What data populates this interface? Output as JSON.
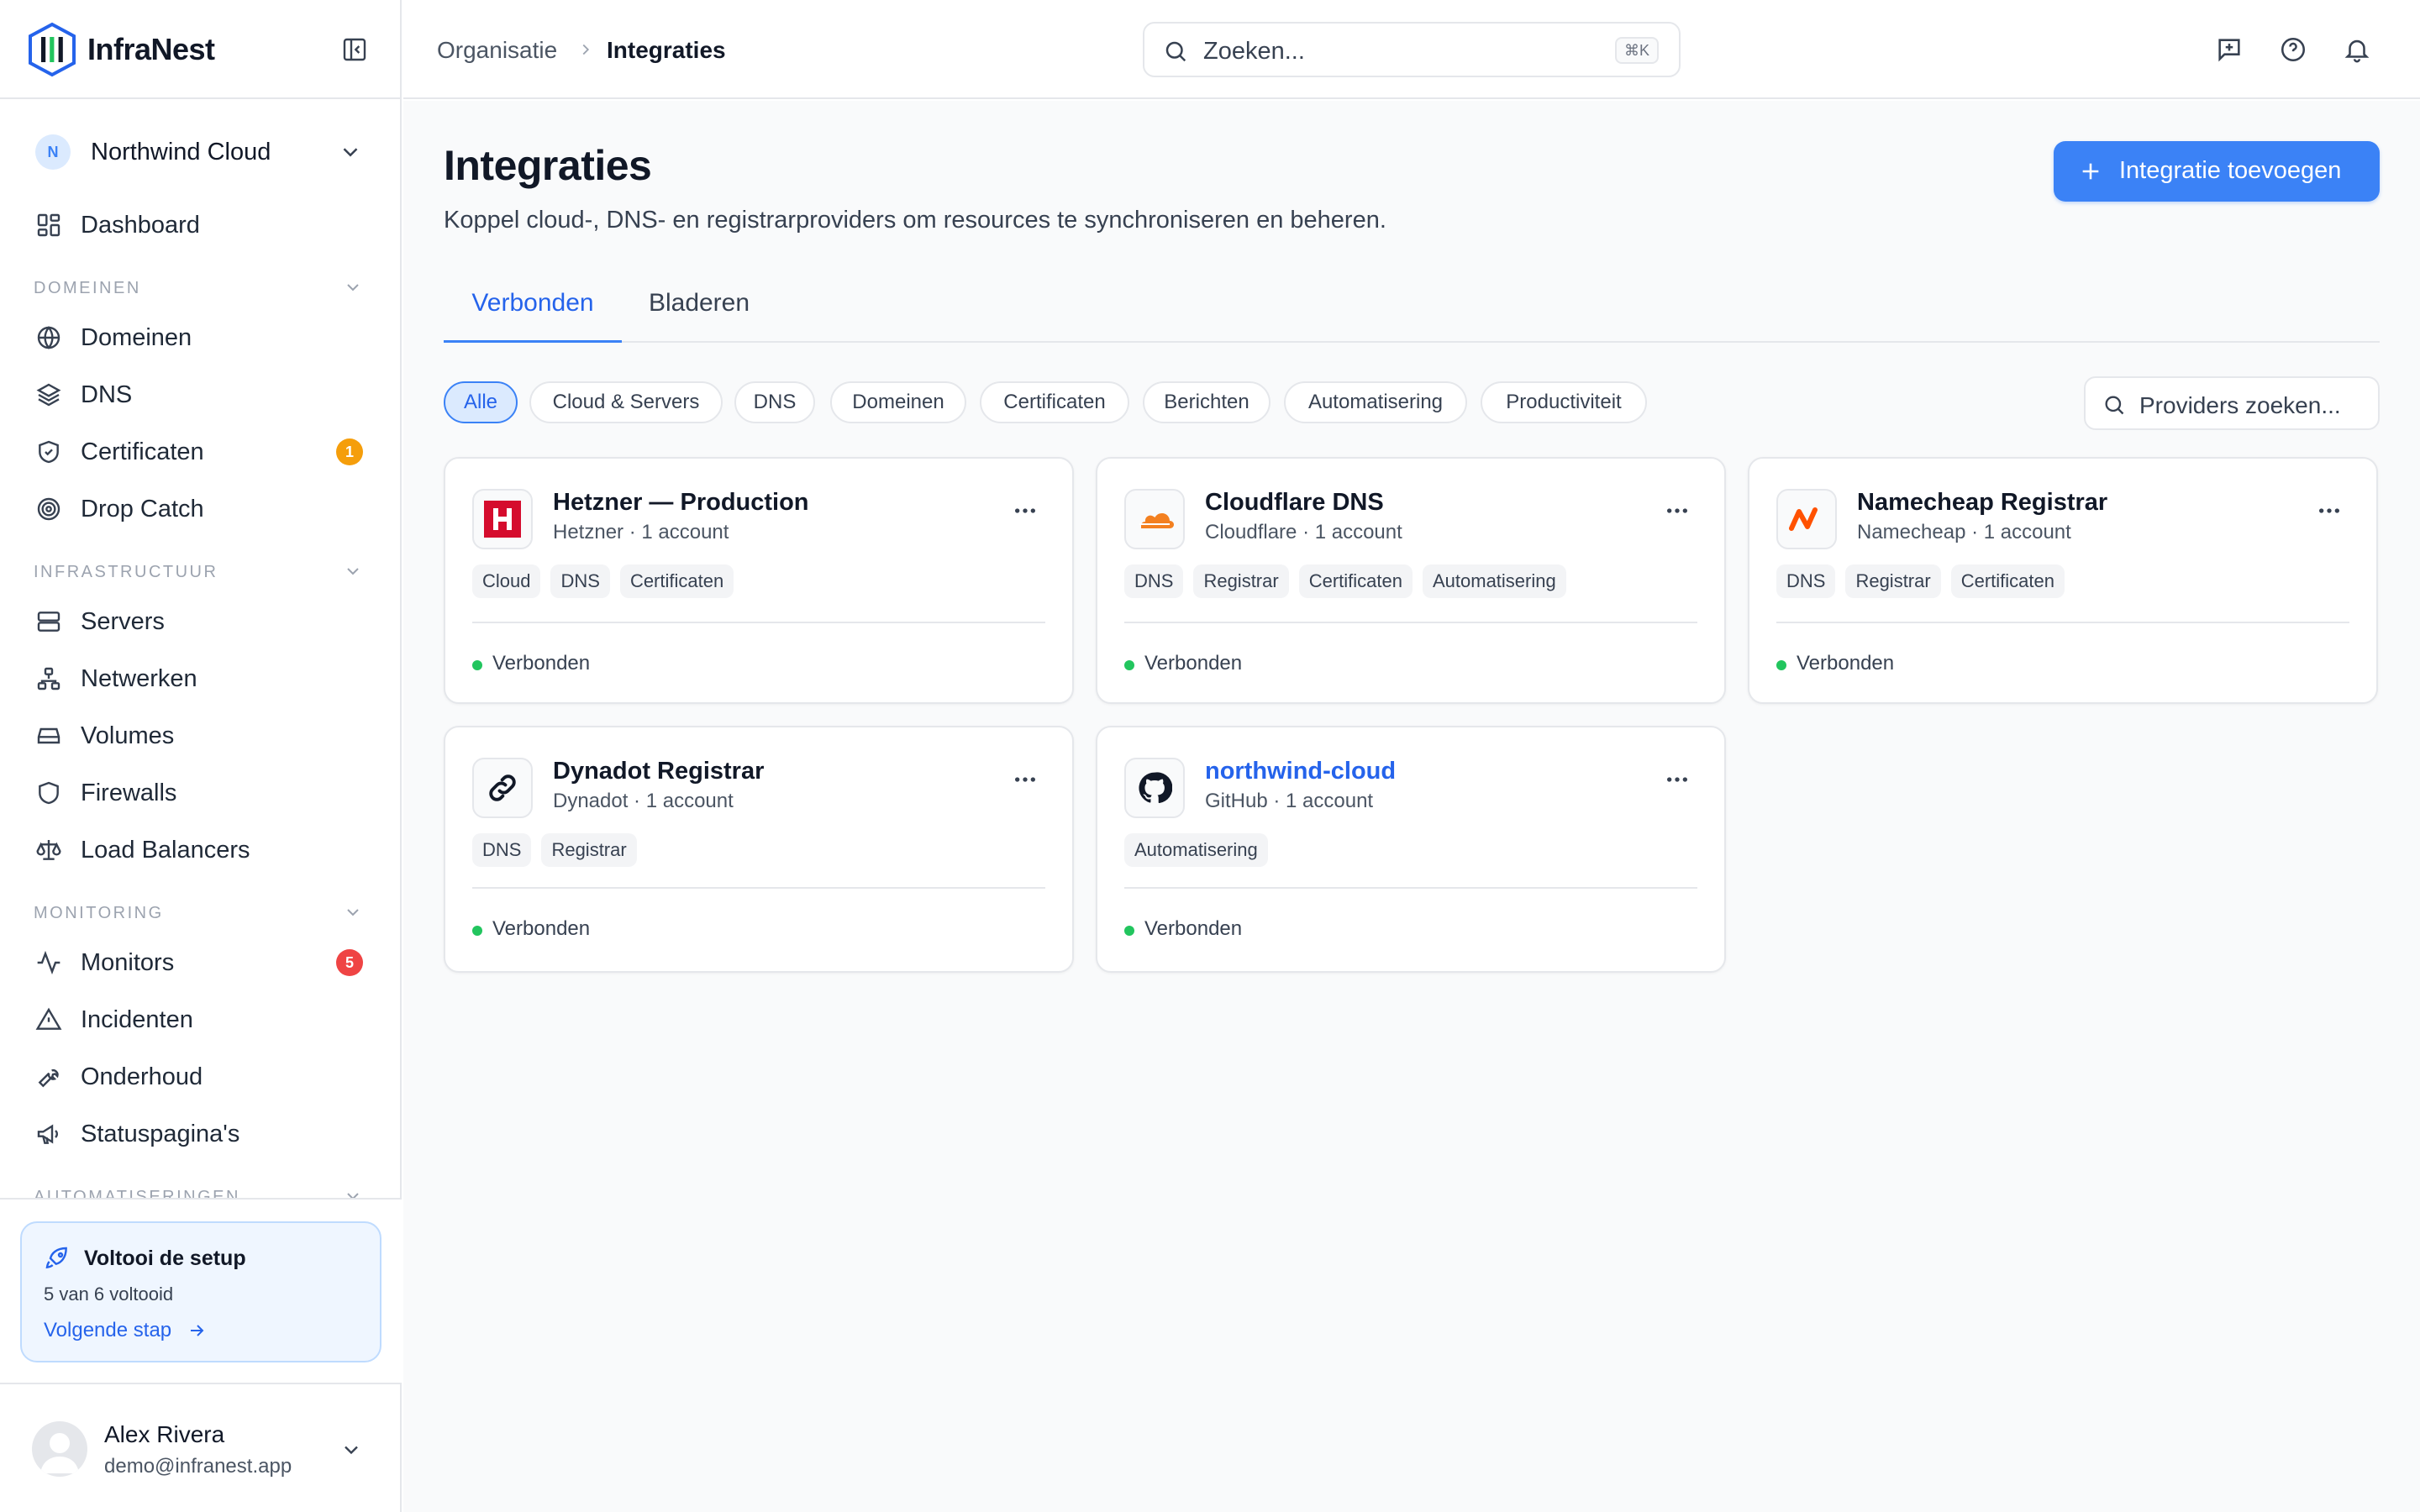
{
  "brand": {
    "name": "InfraNest"
  },
  "org": {
    "initial": "N",
    "name": "Northwind Cloud"
  },
  "nav": {
    "dashboard": "Dashboard",
    "domains_section": "DOMEINEN",
    "domains": "Domeinen",
    "dns": "DNS",
    "certificates": "Certificaten",
    "certificates_badge": "1",
    "drop_catch": "Drop Catch",
    "infra_section": "INFRASTRUCTUUR",
    "servers": "Servers",
    "networks": "Netwerken",
    "volumes": "Volumes",
    "firewalls": "Firewalls",
    "load_balancers": "Load Balancers",
    "monitoring_section": "MONITORING",
    "monitors": "Monitors",
    "monitors_badge": "5",
    "incidents": "Incidenten",
    "maintenance": "Onderhoud",
    "status_pages": "Statuspagina's",
    "automations_section": "AUTOMATISERINGEN"
  },
  "setup": {
    "title": "Voltooi de setup",
    "progress": "5 van 6 voltooid",
    "next": "Volgende stap"
  },
  "user": {
    "name": "Alex Rivera",
    "email": "demo@infranest.app"
  },
  "breadcrumb": {
    "parent": "Organisatie",
    "current": "Integraties"
  },
  "search": {
    "placeholder": "Zoeken...",
    "shortcut": "⌘K"
  },
  "page": {
    "title": "Integraties",
    "description": "Koppel cloud-, DNS- en registrarproviders om resources te synchroniseren en beheren.",
    "add_button": "Integratie toevoegen"
  },
  "tabs": {
    "connected": "Verbonden",
    "browse": "Bladeren"
  },
  "filters": [
    "Alle",
    "Cloud & Servers",
    "DNS",
    "Domeinen",
    "Certificaten",
    "Berichten",
    "Automatisering",
    "Productiviteit"
  ],
  "provider_search": {
    "placeholder": "Providers zoeken..."
  },
  "colors": {
    "accent": "#3b82f6",
    "connected": "#22c55e",
    "hetzner": "#d50c2d",
    "cloudflare": "#f38020",
    "namecheap": "#ff5100"
  },
  "integrations": [
    {
      "name": "Hetzner — Production",
      "meta": "Hetzner · 1 account",
      "tags": [
        "Cloud",
        "DNS",
        "Certificaten"
      ],
      "status": "Verbonden",
      "icon": "hetzner-logo-icon"
    },
    {
      "name": "Cloudflare DNS",
      "meta": "Cloudflare · 1 account",
      "tags": [
        "DNS",
        "Registrar",
        "Certificaten",
        "Automatisering"
      ],
      "status": "Verbonden",
      "icon": "cloudflare-logo-icon"
    },
    {
      "name": "Namecheap Registrar",
      "meta": "Namecheap · 1 account",
      "tags": [
        "DNS",
        "Registrar",
        "Certificaten"
      ],
      "status": "Verbonden",
      "icon": "namecheap-logo-icon"
    },
    {
      "name": "Dynadot Registrar",
      "meta": "Dynadot · 1 account",
      "tags": [
        "DNS",
        "Registrar"
      ],
      "status": "Verbonden",
      "icon": "dynadot-logo-icon"
    },
    {
      "name": "northwind-cloud",
      "meta": "GitHub · 1 account",
      "tags": [
        "Automatisering"
      ],
      "status": "Verbonden",
      "icon": "github-logo-icon"
    }
  ]
}
